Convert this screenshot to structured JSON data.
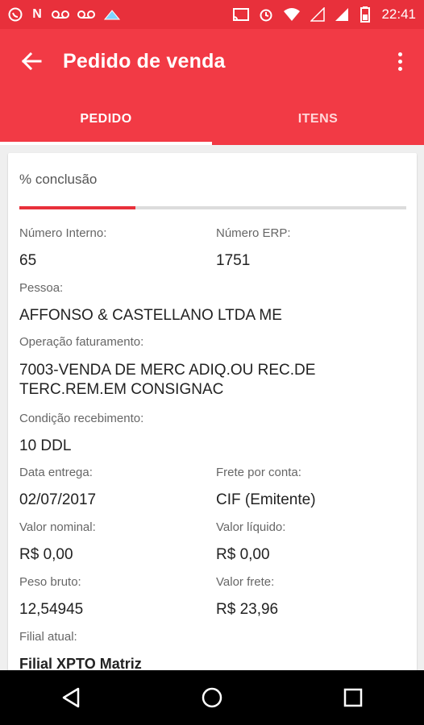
{
  "status_bar": {
    "time": "22:41",
    "left_icons": [
      "whatsapp-icon",
      "netflix-icon",
      "voicemail-icon",
      "voicemail-icon",
      "cloud-app-icon"
    ],
    "right_icons": [
      "cast-icon",
      "alarm-icon",
      "wifi-icon",
      "signal-icon",
      "signal-icon",
      "battery-icon"
    ]
  },
  "app_bar": {
    "title": "Pedido de venda",
    "back_icon": "arrow-back-icon",
    "menu_icon": "more-vert-icon"
  },
  "tabs": [
    {
      "label": "PEDIDO",
      "active": true
    },
    {
      "label": "ITENS",
      "active": false
    }
  ],
  "progress": {
    "label": "% conclusão",
    "fraction": 0.3
  },
  "fields": {
    "numero_interno": {
      "label": "Número Interno:",
      "value": "65"
    },
    "numero_erp": {
      "label": "Número ERP:",
      "value": "1751"
    },
    "pessoa": {
      "label": "Pessoa:",
      "value": "AFFONSO & CASTELLANO LTDA ME"
    },
    "operacao_faturamento": {
      "label": "Operação faturamento:",
      "value_line1": "7003-VENDA DE MERC ADIQ.OU REC.DE",
      "value_line2": "TERC.REM.EM CONSIGNAC"
    },
    "condicao_recebimento": {
      "label": "Condição recebimento:",
      "value": "10 DDL"
    },
    "data_entrega": {
      "label": "Data entrega:",
      "value": "02/07/2017"
    },
    "frete_por_conta": {
      "label": "Frete por conta:",
      "value": "CIF (Emitente)"
    },
    "valor_nominal": {
      "label": "Valor nominal:",
      "value": "R$ 0,00"
    },
    "valor_liquido": {
      "label": "Valor líquido:",
      "value": "R$ 0,00"
    },
    "peso_bruto": {
      "label": "Peso bruto:",
      "value": "12,54945"
    },
    "valor_frete": {
      "label": "Valor frete:",
      "value": "R$ 23,96"
    },
    "filial_atual": {
      "label": "Filial atual:",
      "value": "Filial XPTO Matriz"
    }
  },
  "nav_bar": {
    "icons": [
      "back-triangle-icon",
      "home-circle-icon",
      "recents-square-icon"
    ]
  },
  "colors": {
    "accent": "#f23a45",
    "status_bar": "#e8303b"
  }
}
